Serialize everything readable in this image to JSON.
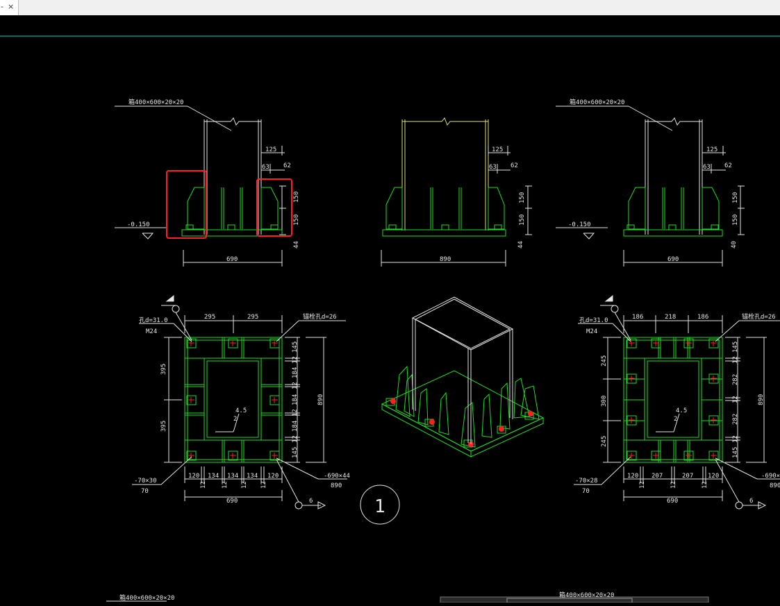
{
  "tab": {
    "glyph": "-",
    "close": "×"
  },
  "colors": {
    "green": "#22dd22",
    "white": "#e6e6e6",
    "yellow": "#e0e070",
    "red": "#ff2020",
    "cyan": "#1ad0d0"
  },
  "elev_left": {
    "plate_label": "箱400×600×20×20",
    "dim_top": "125",
    "dim_a": "63",
    "dim_b": "62",
    "dim_v1": "150",
    "dim_v2": "150",
    "dim_base": "44",
    "level": "-0.150",
    "width": "690"
  },
  "elev_mid": {
    "dim_top": "125",
    "dim_a": "63",
    "dim_b": "62",
    "dim_v1": "150",
    "dim_v2": "150",
    "dim_base": "44",
    "width": "890"
  },
  "elev_right": {
    "plate_label": "箱400×600×20×20",
    "dim_top": "125",
    "dim_a": "63",
    "dim_b": "62",
    "dim_v1": "150",
    "dim_v2": "150",
    "dim_base": "40",
    "level": "-0.150",
    "width": "690"
  },
  "plan_left": {
    "hole_label": "孔d=31.0",
    "bolt_label": "M24",
    "anchor_label": "锚栓孔d=26",
    "top_dims": [
      "295",
      "295"
    ],
    "left_dims": [
      "395",
      "395"
    ],
    "right_dims": [
      "145",
      "12",
      "184",
      "12",
      "184",
      "12",
      "184",
      "12",
      "145"
    ],
    "height": "890",
    "bottom_dims": [
      "120",
      "134",
      "134",
      "134",
      "120"
    ],
    "gaps": [
      "12",
      "12",
      "12",
      "12"
    ],
    "width": "690",
    "weld_size": "4.5",
    "weld_2": "2",
    "stiffener": "-70×30",
    "stiffener_2": "70",
    "base_plate": "-690×44",
    "base_plate_2": "890",
    "section_mark": "6"
  },
  "plan_right": {
    "hole_label": "孔d=31.0",
    "bolt_label": "M24",
    "anchor_label": "锚栓孔d=26",
    "top_dims": [
      "186",
      "218",
      "186"
    ],
    "left_dims": [
      "245",
      "300",
      "245"
    ],
    "right_dims": [
      "145",
      "12",
      "282",
      "12",
      "282",
      "12",
      "145"
    ],
    "height": "890",
    "bottom_dims": [
      "120",
      "207",
      "207",
      "120"
    ],
    "gaps": [
      "12",
      "12",
      "12"
    ],
    "width": "690",
    "weld_size": "4.5",
    "weld_2": "2",
    "stiffener": "-70×28",
    "stiffener_2": "70",
    "base_plate": "-690×",
    "base_plate_2": "890",
    "section_mark": "6"
  },
  "detail_number": "1",
  "bottom_labels": [
    "箱400×600×20×20",
    "箱400×600×20×20"
  ]
}
